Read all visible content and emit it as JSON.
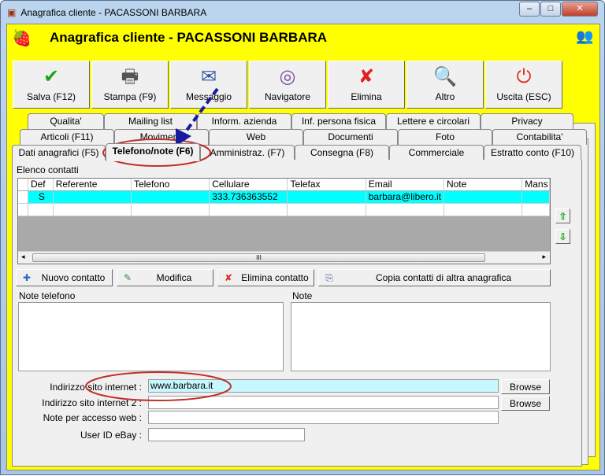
{
  "window": {
    "title": "Anagrafica cliente - PACASSONI BARBARA",
    "minimize": "‒",
    "maximize": "□",
    "close": "✕"
  },
  "header": {
    "title": "Anagrafica cliente - PACASSONI BARBARA",
    "logo_icon": "strawberries-icon",
    "users_icon": "users-icon"
  },
  "toolbar": [
    {
      "label": "Salva (F12)",
      "icon": "check-icon",
      "glyph": "✔",
      "color": "#1aa81a"
    },
    {
      "label": "Stampa (F9)",
      "icon": "printer-icon",
      "glyph": "🖶",
      "color": "#555555"
    },
    {
      "label": "Messaggio",
      "icon": "message-icon",
      "glyph": "✉",
      "color": "#3355aa"
    },
    {
      "label": "Navigatore",
      "icon": "compass-icon",
      "glyph": "◎",
      "color": "#7a4fa0"
    },
    {
      "label": "Elimina",
      "icon": "delete-icon",
      "glyph": "✘",
      "color": "#e02020"
    },
    {
      "label": "Altro",
      "icon": "search-icon",
      "glyph": "🔍",
      "color": "#2a6acc"
    },
    {
      "label": "Uscita (ESC)",
      "icon": "power-icon",
      "glyph": "⏻",
      "color": "#e03020"
    }
  ],
  "tabs": {
    "row1": [
      "Qualita'",
      "Mailing list",
      "Inform. azienda",
      "Inf. persona fisica",
      "Lettere e circolari",
      "Privacy"
    ],
    "row2": [
      "Articoli (F11)",
      "Movimenti",
      "Web",
      "Documenti",
      "Foto",
      "Contabilita'"
    ],
    "row3": [
      "Dati anagrafici (F5)",
      "Telefono/note (F6)",
      "Amministraz. (F7)",
      "Consegna (F8)",
      "Commerciale",
      "Estratto conto (F10)"
    ],
    "selected": "Telefono/note (F6)"
  },
  "contacts": {
    "label": "Elenco contatti",
    "columns": [
      "Def",
      "Referente",
      "Telefono",
      "Cellulare",
      "Telefax",
      "Email",
      "Note",
      "Mans"
    ],
    "rows": [
      [
        "S",
        "",
        "",
        "333.736363552",
        "",
        "barbara@libero.it",
        "",
        ""
      ],
      [
        "",
        "",
        "",
        "",
        "",
        "",
        "",
        ""
      ]
    ],
    "scroll_grip": "III"
  },
  "buttons": {
    "new": "Nuovo contatto",
    "edit": "Modifica",
    "delete": "Elimina contatto",
    "copy": "Copia contatti di altra anagrafica"
  },
  "notes": {
    "phone_label": "Note telefono",
    "note_label": "Note",
    "phone_value": "",
    "note_value": ""
  },
  "fields": {
    "site1_label": "Indirizzo sito internet :",
    "site1_value": "www.barbara.it",
    "site2_label": "Indirizzo sito internet 2 :",
    "site2_value": "",
    "web_label": "Note per accesso web :",
    "web_value": "",
    "ebay_label": "User ID eBay :",
    "ebay_value": "",
    "browse": "Browse"
  },
  "colors": {
    "header_bg": "#ffff00",
    "highlight_row": "#00ffff",
    "url_field": "#c8f8ff",
    "annotation_red": "#c0302a",
    "annotation_arrow": "#1a1aa0"
  }
}
